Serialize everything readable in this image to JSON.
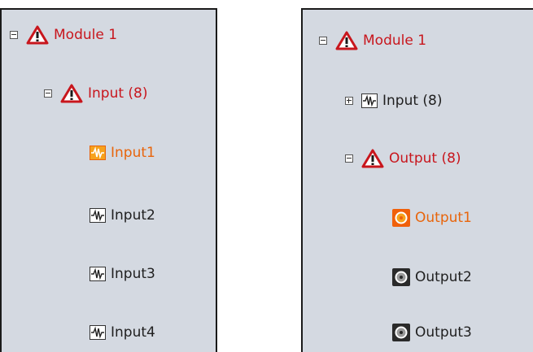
{
  "left_tree": {
    "module": {
      "label": "Module 1"
    },
    "group": {
      "label": "Input (8)"
    },
    "items": [
      {
        "label": "Input1",
        "selected": true
      },
      {
        "label": "Input2",
        "selected": false
      },
      {
        "label": "Input3",
        "selected": false
      },
      {
        "label": "Input4",
        "selected": false
      }
    ]
  },
  "right_tree": {
    "module": {
      "label": "Module 1"
    },
    "collapsed_group": {
      "label": "Input (8)"
    },
    "group": {
      "label": "Output (8)"
    },
    "items": [
      {
        "label": "Output1",
        "selected": true
      },
      {
        "label": "Output2",
        "selected": false
      },
      {
        "label": "Output3",
        "selected": false
      }
    ]
  },
  "colors": {
    "warning": "#c8161d",
    "selected": "#e8650c",
    "panel": "#d4d9e1"
  },
  "icons": [
    "warning-icon",
    "waveform-icon",
    "speaker-icon",
    "collapse-icon",
    "expand-icon"
  ]
}
